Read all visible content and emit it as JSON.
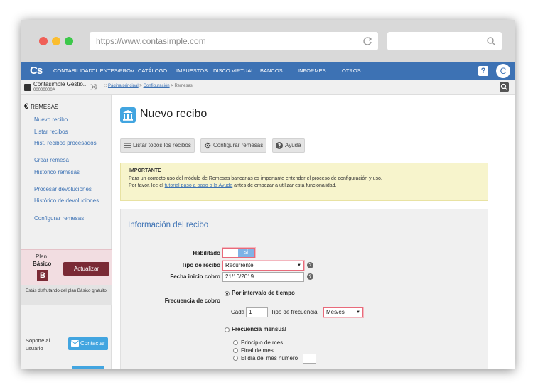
{
  "browser": {
    "url": "https://www.contasimple.com"
  },
  "topnav": {
    "logo": "Cs",
    "items": [
      "CONTABILIDAD",
      "CLIENTES/PROV.",
      "CATÁLOGO",
      "IMPUESTOS",
      "DISCO VIRTUAL",
      "BANCOS",
      "INFORMES",
      "OTROS"
    ],
    "help": "?",
    "avatar": "C"
  },
  "subbar": {
    "company_name": "Contasimple Gestio...",
    "company_code": "00000000A",
    "breadcrumb": {
      "separator": "::",
      "home": "Página principal",
      "config": "Configuración",
      "current": "Remesas"
    }
  },
  "sidebar": {
    "section": "REMESAS",
    "links": [
      "Nuevo recibo",
      "Listar recibos",
      "Hist. recibos procesados",
      "Crear remesa",
      "Histórico remesas",
      "Procesar devoluciones",
      "Histórico de devoluciones",
      "Configurar remesas"
    ],
    "plan": {
      "label": "Plan",
      "name": "Básico",
      "badge": "B",
      "upgrade": "Actualizar",
      "info": "Estás disfrutando del plan Básico gratuito."
    },
    "support": "Soporte al usuario",
    "contact": "Contactar"
  },
  "main": {
    "title": "Nuevo recibo",
    "toolbar": {
      "list": "Listar todos los recibos",
      "config": "Configurar remesas",
      "help": "Ayuda"
    },
    "notice": {
      "header": "IMPORTANTE",
      "line1": "Para un correcto uso del módulo de Remesas bancarias es importante entender el proceso de configuración y uso.",
      "line2_pre": "Por favor, lee el",
      "line2_link": "tutorial paso a paso o la Ayuda",
      "line2_post": "antes de empezar a utilizar esta funcionalidad."
    },
    "form": {
      "title": "Información del recibo",
      "enabled_label": "Habilitado",
      "enabled_value": "sí",
      "type_label": "Tipo de recibo",
      "type_value": "Recurrente",
      "start_label": "Fecha inicio cobro",
      "start_value": "21/10/2019",
      "freq_label": "Frecuencia de cobro",
      "freq_interval": "Por intervalo de tiempo",
      "every_label": "Cada",
      "every_value": "1",
      "freq_type_label": "Tipo de frecuencia:",
      "freq_type_value": "Mes/es",
      "freq_monthly": "Frecuencia mensual",
      "month_start": "Principio de mes",
      "month_end": "Final de mes",
      "month_day": "El día del mes número"
    }
  }
}
